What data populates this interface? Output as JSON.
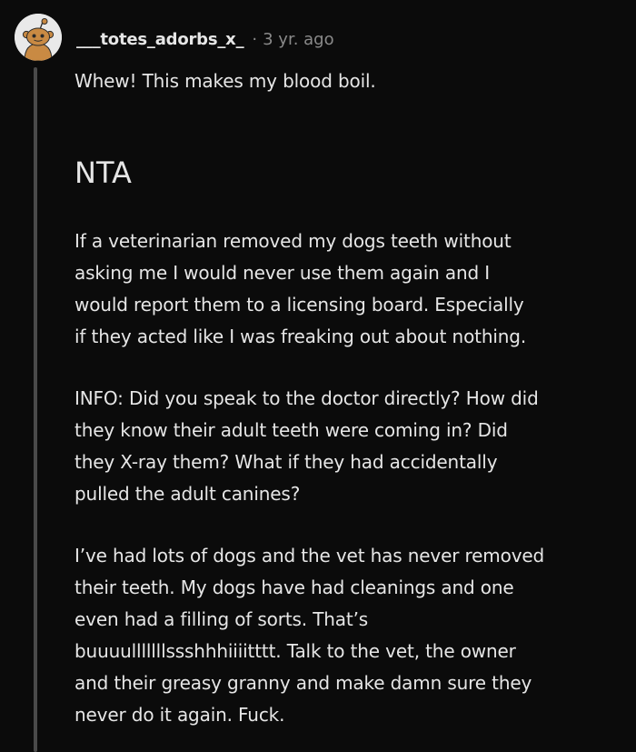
{
  "comment": {
    "username": "___totes_adorbs_x_",
    "separator": "·",
    "timestamp": "3 yr. ago",
    "avatar_icon": "reddit-snoo-avatar-icon",
    "colors": {
      "background": "#0b0b0b",
      "text": "#e6e6e6",
      "meta": "#8a8a8a",
      "thread_line": "#4a4a4a"
    },
    "body": {
      "p1": "Whew! This makes my blood boil.",
      "heading": "NTA",
      "p2_lines": [
        "If a veterinarian removed my dogs teeth without",
        "asking me I would never use them again and I",
        "would report them to a licensing board. Especially",
        "if they acted like I was freaking out about nothing."
      ],
      "p3_lines": [
        "INFO: Did you speak to the doctor directly? How did",
        "they know their adult teeth were coming in? Did",
        "they X-ray them? What if they had accidentally",
        "pulled the adult canines?"
      ],
      "p4_lines": [
        "I’ve had lots of dogs and the vet has never removed",
        "their teeth. My dogs have had cleanings and one",
        "even had a filling of sorts. That’s",
        "buuuulllllllssshhhiiiitttt. Talk to the vet, the owner",
        "and their greasy granny and make damn sure they",
        "never do it again. Fuck."
      ]
    }
  }
}
